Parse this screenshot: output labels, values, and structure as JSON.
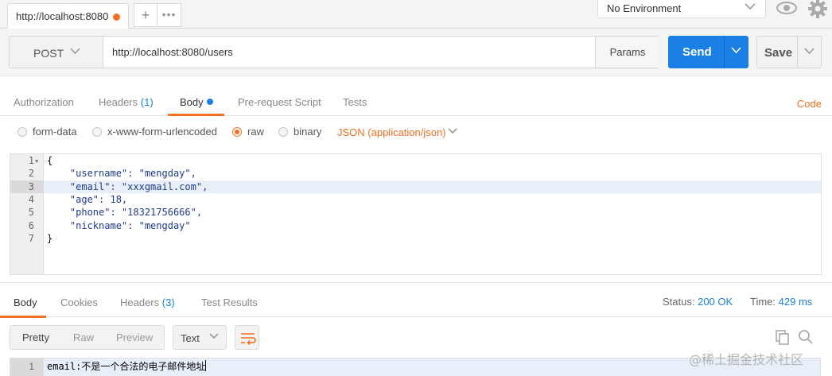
{
  "request_tab": {
    "title": "http://localhost:8080"
  },
  "environment": {
    "selected": "No Environment"
  },
  "request": {
    "method": "POST",
    "url": "http://localhost:8080/users",
    "params_label": "Params",
    "send_label": "Send",
    "save_label": "Save"
  },
  "request_tabs": {
    "authorization": "Authorization",
    "headers": "Headers",
    "headers_count": "(1)",
    "body": "Body",
    "prerequest": "Pre-request Script",
    "tests": "Tests",
    "code": "Code"
  },
  "body_modes": {
    "form_data": "form-data",
    "urlencoded": "x-www-form-urlencoded",
    "raw": "raw",
    "binary": "binary",
    "selected": "raw",
    "content_type": "JSON (application/json)"
  },
  "request_body": {
    "lines": [
      {
        "n": "1",
        "text": "{"
      },
      {
        "n": "2",
        "text": "    \"username\": \"mengday\","
      },
      {
        "n": "3",
        "text": "    \"email\": \"xxxgmail.com\","
      },
      {
        "n": "4",
        "text": "    \"age\": 18,"
      },
      {
        "n": "5",
        "text": "    \"phone\": \"18321756666\","
      },
      {
        "n": "6",
        "text": "    \"nickname\": \"mengday\""
      },
      {
        "n": "7",
        "text": "}"
      }
    ],
    "highlighted_line": 3
  },
  "response_tabs": {
    "body": "Body",
    "cookies": "Cookies",
    "headers": "Headers",
    "headers_count": "(3)",
    "test_results": "Test Results",
    "status_label": "Status:",
    "status_value": "200 OK",
    "time_label": "Time:",
    "time_value": "429 ms"
  },
  "response_format": {
    "pretty": "Pretty",
    "raw": "Raw",
    "preview": "Preview",
    "type": "Text"
  },
  "response_body": {
    "line_number": "1",
    "text": "email:不是一个合法的电子邮件地址"
  },
  "watermark": "@稀土掘金技术社区",
  "colors": {
    "accent": "#f47023",
    "primary": "#1a80e6"
  }
}
